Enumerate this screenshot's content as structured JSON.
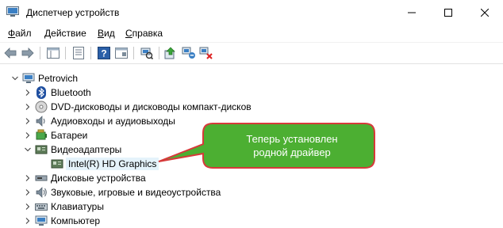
{
  "window": {
    "title": "Диспетчер устройств",
    "buttons": {
      "minimize_icon": "minimize-icon",
      "maximize_icon": "maximize-icon",
      "close_icon": "close-icon"
    }
  },
  "menu": [
    {
      "label": "Файл",
      "ul": "Ф",
      "rest": "айл"
    },
    {
      "label": "Действие",
      "ul": "Д",
      "rest": "ействие"
    },
    {
      "label": "Вид",
      "ul": "В",
      "rest": "ид"
    },
    {
      "label": "Справка",
      "ul": "С",
      "rest": "правка"
    }
  ],
  "toolbar": [
    "back-icon",
    "forward-icon",
    "properties-pane-icon",
    "console-tree-icon",
    "help-icon",
    "show-hide-icon",
    "scan-hardware-icon",
    "update-driver-icon",
    "disable-device-icon",
    "uninstall-device-icon"
  ],
  "tree": {
    "root": "Petrovich",
    "items": [
      {
        "label": "Bluetooth",
        "icon": "bluetooth-icon",
        "expanded": false
      },
      {
        "label": "DVD-дисководы и дисководы компакт-дисков",
        "icon": "dvd-drive-icon",
        "expanded": false
      },
      {
        "label": "Аудиовходы и аудиовыходы",
        "icon": "audio-icon",
        "expanded": false
      },
      {
        "label": "Батареи",
        "icon": "battery-icon",
        "expanded": false
      },
      {
        "label": "Видеоадаптеры",
        "icon": "display-adapter-icon",
        "expanded": true
      },
      {
        "label": "Intel(R) HD Graphics",
        "icon": "display-adapter-icon",
        "child": true
      },
      {
        "label": "Дисковые устройства",
        "icon": "disk-drive-icon",
        "expanded": false
      },
      {
        "label": "Звуковые, игровые и видеоустройства",
        "icon": "sound-icon",
        "expanded": false
      },
      {
        "label": "Клавиатуры",
        "icon": "keyboard-icon",
        "expanded": false
      },
      {
        "label": "Компьютер",
        "icon": "computer-icon",
        "expanded": false
      }
    ]
  },
  "callout": {
    "line1": "Теперь установлен",
    "line2": "родной драйвер",
    "fill": "#4caf32",
    "border": "#d63a3a"
  }
}
